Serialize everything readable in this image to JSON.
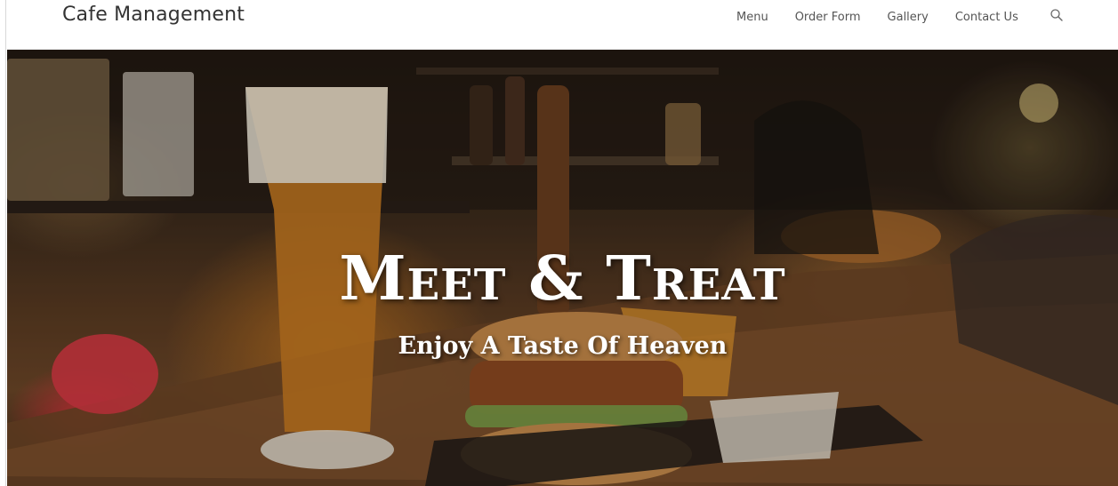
{
  "header": {
    "brand": "Cafe Management",
    "nav": [
      {
        "label": "Menu"
      },
      {
        "label": "Order Form"
      },
      {
        "label": "Gallery"
      },
      {
        "label": "Contact Us"
      }
    ],
    "search_icon": "search-icon"
  },
  "hero": {
    "title": "Meet & Treat",
    "subtitle": "Enjoy A Taste Of Heaven"
  },
  "colors": {
    "header_bg": "#ffffff",
    "brand_text": "#333333",
    "nav_text": "#555555",
    "hero_text": "#ffffff"
  }
}
